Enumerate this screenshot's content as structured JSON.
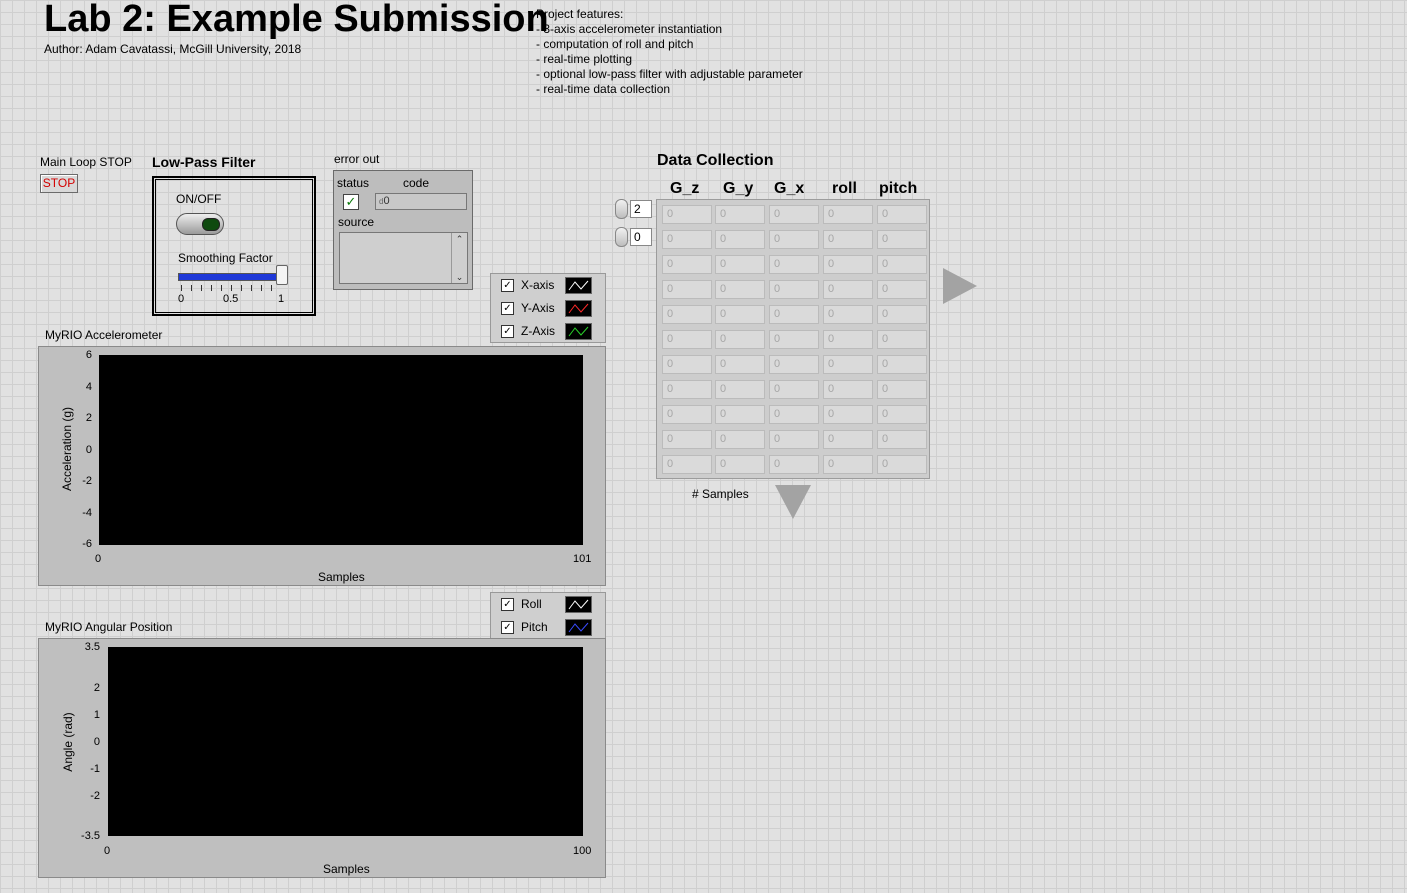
{
  "header": {
    "title": "Lab 2: Example Submission",
    "author": "Author: Adam Cavatassi, McGill University, 2018",
    "features_title": "Project features:",
    "features": [
      "- 3-axis accelerometer instantiation",
      "- computation of roll and pitch",
      "- real-time plotting",
      "- optional low-pass filter with adjustable parameter",
      "- real-time data collection"
    ]
  },
  "main_stop": {
    "label": "Main Loop STOP",
    "button": "STOP"
  },
  "low_pass": {
    "title": "Low-Pass Filter",
    "switch_label": "ON/OFF",
    "switch_on": false,
    "slider_label": "Smoothing Factor",
    "slider_value": 1,
    "scale": [
      "0",
      "0.5",
      "1"
    ]
  },
  "error_out": {
    "title": "error out",
    "status_label": "status",
    "code_label": "code",
    "status_ok": true,
    "code_value": "0",
    "code_prefix": "d",
    "source_label": "source"
  },
  "accel_graph": {
    "title": "MyRIO Accelerometer",
    "ylabel": "Acceleration (g)",
    "xlabel": "Samples",
    "y_ticks": [
      "6",
      "4",
      "2",
      "0",
      "-2",
      "-4",
      "-6"
    ],
    "x_ticks": [
      "0",
      "101"
    ],
    "legend": [
      {
        "name": "X-axis",
        "checked": true,
        "color": "#ffffff"
      },
      {
        "name": "Y-Axis",
        "checked": true,
        "color": "#ff2a2a"
      },
      {
        "name": "Z-Axis",
        "checked": true,
        "color": "#2ad22a"
      }
    ]
  },
  "angle_graph": {
    "title": "MyRIO Angular Position",
    "ylabel": "Angle (rad)",
    "xlabel": "Samples",
    "y_ticks": [
      "3.5",
      "2",
      "1",
      "0",
      "-1",
      "-2",
      "-3.5"
    ],
    "x_ticks": [
      "0",
      "100"
    ],
    "legend": [
      {
        "name": "Roll",
        "checked": true,
        "color": "#ffffff"
      },
      {
        "name": "Pitch",
        "checked": true,
        "color": "#3a4cff"
      }
    ]
  },
  "data_collection": {
    "title": "Data Collection",
    "columns": [
      "G_z",
      "G_y",
      "G_x",
      "roll",
      "pitch"
    ],
    "row_index": "2",
    "col_index": "0",
    "rows": [
      [
        "0",
        "0",
        "0",
        "0",
        "0"
      ],
      [
        "0",
        "0",
        "0",
        "0",
        "0"
      ],
      [
        "0",
        "0",
        "0",
        "0",
        "0"
      ],
      [
        "0",
        "0",
        "0",
        "0",
        "0"
      ],
      [
        "0",
        "0",
        "0",
        "0",
        "0"
      ],
      [
        "0",
        "0",
        "0",
        "0",
        "0"
      ],
      [
        "0",
        "0",
        "0",
        "0",
        "0"
      ],
      [
        "0",
        "0",
        "0",
        "0",
        "0"
      ],
      [
        "0",
        "0",
        "0",
        "0",
        "0"
      ],
      [
        "0",
        "0",
        "0",
        "0",
        "0"
      ],
      [
        "0",
        "0",
        "0",
        "0",
        "0"
      ]
    ],
    "samples_label": "# Samples"
  }
}
